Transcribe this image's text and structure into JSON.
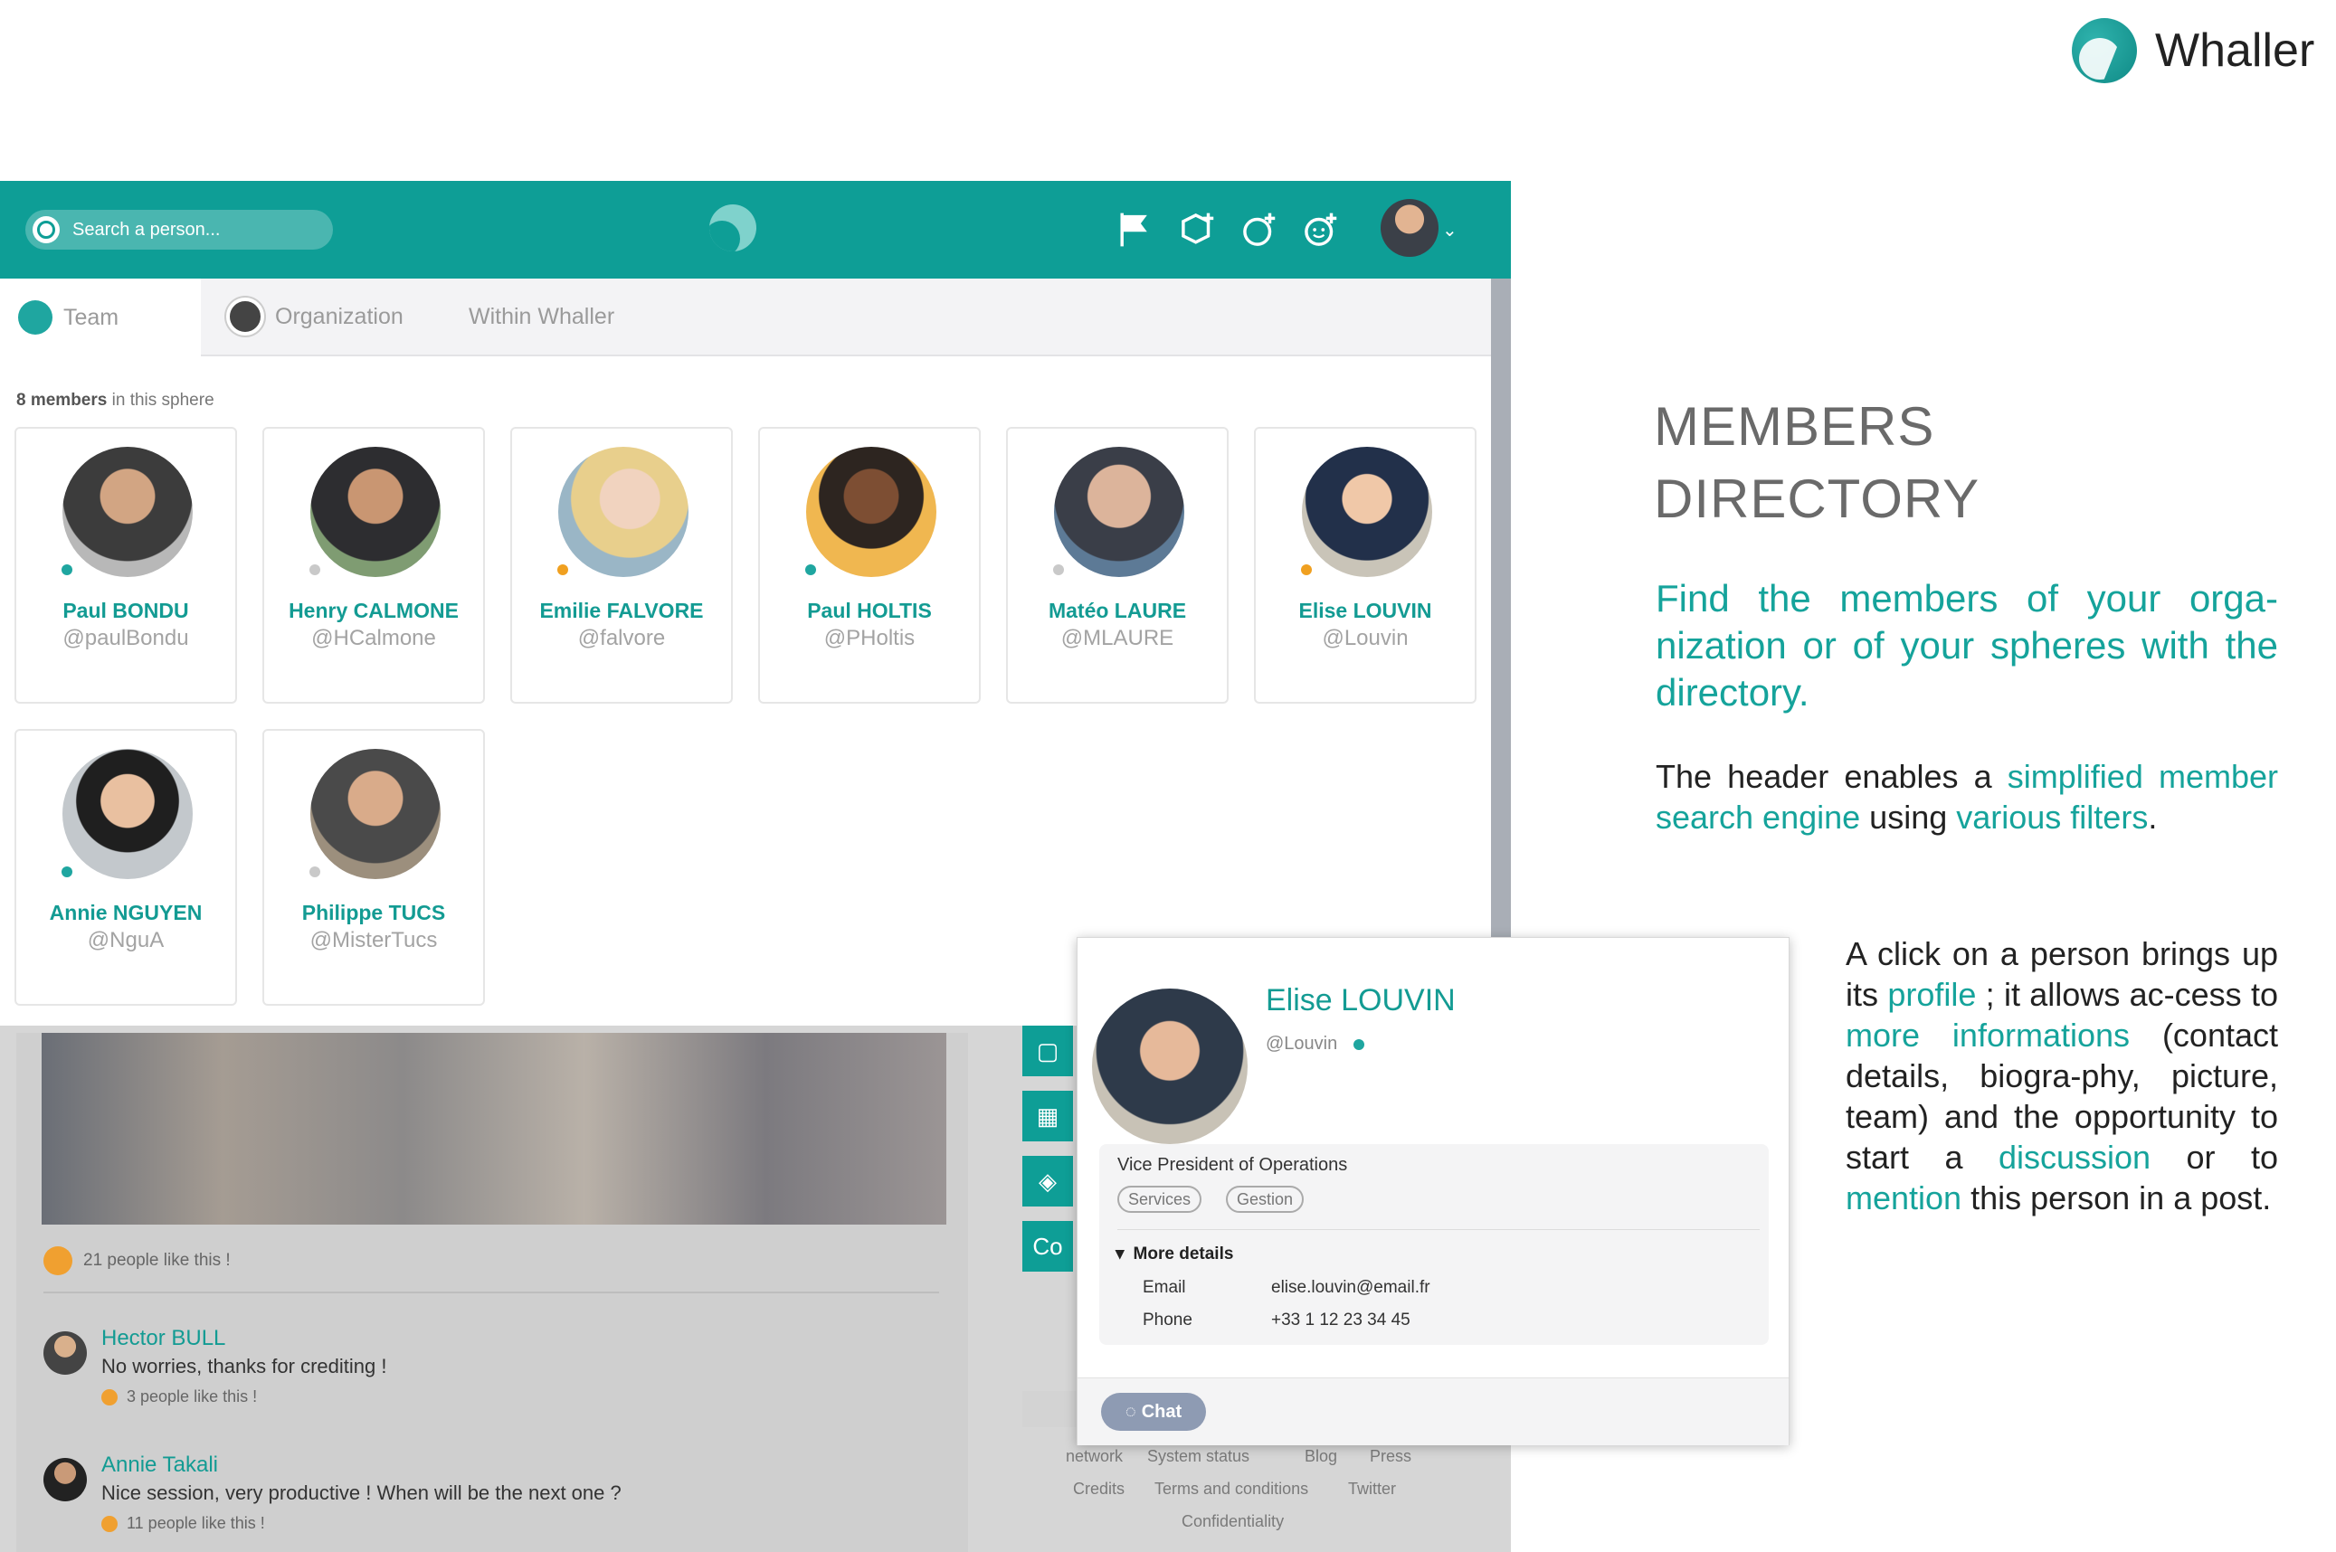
{
  "brand": {
    "name": "Whaller"
  },
  "topbar": {
    "search_placeholder": "Search a person...",
    "icons": [
      "flag-icon",
      "add-sphere-icon",
      "add-conversation-icon",
      "add-user-icon"
    ]
  },
  "tabs": {
    "team": "Team",
    "organization": "Organization",
    "within": "Within Whaller"
  },
  "directory": {
    "count_number": "8 members",
    "count_suffix": " in this sphere",
    "members": [
      {
        "name": "Paul BONDU",
        "handle": "@paulBondu",
        "status": "#1fa6a0"
      },
      {
        "name": "Henry CALMONE",
        "handle": "@HCalmone",
        "status": "#c9c9c9"
      },
      {
        "name": "Emilie FALVORE",
        "handle": "@falvore",
        "status": "#f0a020"
      },
      {
        "name": "Paul HOLTIS",
        "handle": "@PHoltis",
        "status": "#1fa6a0"
      },
      {
        "name": "Matéo LAURE",
        "handle": "@MLAURE",
        "status": "#c9c9c9"
      },
      {
        "name": "Elise LOUVIN",
        "handle": "@Louvin",
        "status": "#f0a020"
      },
      {
        "name": "Annie NGUYEN",
        "handle": "@NguA",
        "status": "#1fa6a0"
      },
      {
        "name": "Philippe TUCS",
        "handle": "@MisterTucs",
        "status": "#c9c9c9"
      }
    ]
  },
  "feed": {
    "likes_main": "21 people like this !",
    "comments": [
      {
        "author": "Hector BULL",
        "text": "No worries, thanks for crediting !",
        "likes": "3 people like this !"
      },
      {
        "author": "Annie Takali",
        "text": "Nice session, very productive ! When will be the next one ?",
        "likes": "11 people like this !"
      }
    ],
    "side_label": "Co",
    "footer_links": {
      "network": "network",
      "status": "System status",
      "blog": "Blog",
      "press": "Press",
      "credits": "Credits",
      "terms": "Terms and conditions",
      "twitter": "Twitter",
      "confidentiality": "Confidentiality"
    }
  },
  "profile": {
    "name": "Elise LOUVIN",
    "handle": "@Louvin",
    "role": "Vice President of Operations",
    "tags": [
      "Services",
      "Gestion"
    ],
    "more_details": "More details",
    "email_label": "Email",
    "email": "elise.louvin@email.fr",
    "phone_label": "Phone",
    "phone": "+33 1 12 23 34 45",
    "chat": "Chat"
  },
  "marketing": {
    "title_line1": "MEMBERS",
    "title_line2": "DIRECTORY",
    "subtitle": "Find the members of your orga-nization or of your spheres with the directory.",
    "p1_a": "The header enables a ",
    "p1_b": "simplified member search engine",
    "p1_c": " using ",
    "p1_d": "various filters",
    "p1_e": ".",
    "p2_a": "A click on a person brings up its ",
    "p2_b": "profile",
    "p2_c": " ; it allows ac-cess to ",
    "p2_d": "more informations",
    "p2_e": " (contact details, biogra-phy, picture, team) and the opportunity to start a ",
    "p2_f": "discussion",
    "p2_g": " or to ",
    "p2_h": "mention",
    "p2_i": " this person in a post."
  },
  "colors": {
    "brand_teal": "#0e9e96",
    "accent_text": "#15a39b"
  }
}
